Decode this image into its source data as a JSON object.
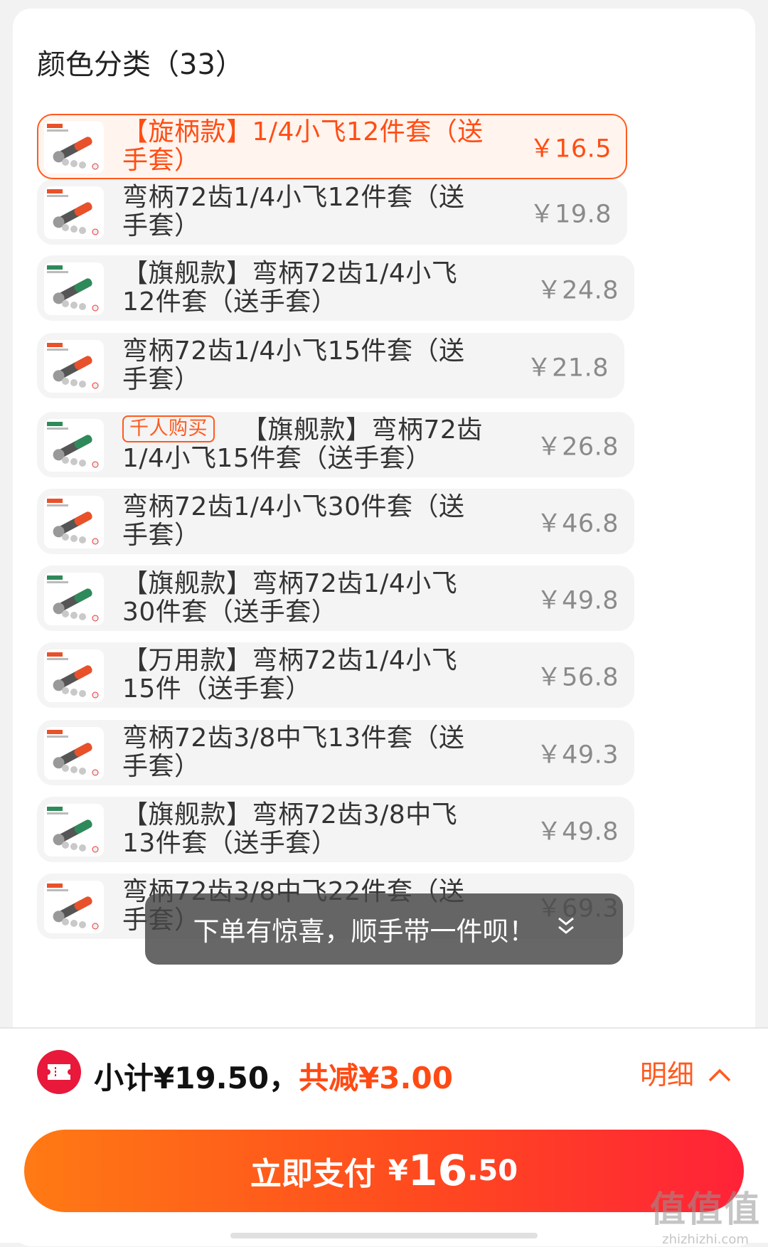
{
  "section": {
    "title": "颜色分类（33）"
  },
  "options": [
    {
      "name": "【旋柄款】1/4小飞12件套（送手套）",
      "price": "￥16.5",
      "selected": true,
      "badge": ""
    },
    {
      "name": "弯柄72齿1/4小飞12件套（送手套）",
      "price": "￥19.8",
      "selected": false,
      "badge": ""
    },
    {
      "name": "【旗舰款】弯柄72齿1/4小飞12件套（送手套）",
      "price": "￥24.8",
      "selected": false,
      "badge": ""
    },
    {
      "name": "弯柄72齿1/4小飞15件套（送手套）",
      "price": "￥21.8",
      "selected": false,
      "badge": ""
    },
    {
      "name": "【旗舰款】弯柄72齿1/4小飞15件套（送手套）",
      "price": "￥26.8",
      "selected": false,
      "badge": "千人购买"
    },
    {
      "name": "弯柄72齿1/4小飞30件套（送手套）",
      "price": "￥46.8",
      "selected": false,
      "badge": ""
    },
    {
      "name": "【旗舰款】弯柄72齿1/4小飞30件套（送手套）",
      "price": "￥49.8",
      "selected": false,
      "badge": ""
    },
    {
      "name": "【万用款】弯柄72齿1/4小飞15件（送手套）",
      "price": "￥56.8",
      "selected": false,
      "badge": ""
    },
    {
      "name": "弯柄72齿3/8中飞13件套（送手套）",
      "price": "￥49.3",
      "selected": false,
      "badge": ""
    },
    {
      "name": "【旗舰款】弯柄72齿3/8中飞13件套（送手套）",
      "price": "￥49.8",
      "selected": false,
      "badge": ""
    },
    {
      "name": "弯柄72齿3/8中飞22件套（送手套）",
      "price": "￥69.3",
      "selected": false,
      "badge": ""
    }
  ],
  "toast": {
    "text": "下单有惊喜，顺手带一件呗！",
    "icon": "chevron-double-down-icon"
  },
  "summary": {
    "subtotal": "小计¥19.50，",
    "discount": "共减¥3.00",
    "detail_label": "明细",
    "coupon_icon": "coupon-ticket-icon"
  },
  "pay": {
    "label": "立即支付",
    "currency": "¥",
    "amount_int": "16",
    "amount_dec": ".50"
  },
  "watermark": {
    "logo": "值值值",
    "url": "zhizhizhi.com"
  },
  "colors": {
    "accent": "#ff5a1f",
    "discount": "#ff4a14",
    "coupon": "#e8193b"
  }
}
